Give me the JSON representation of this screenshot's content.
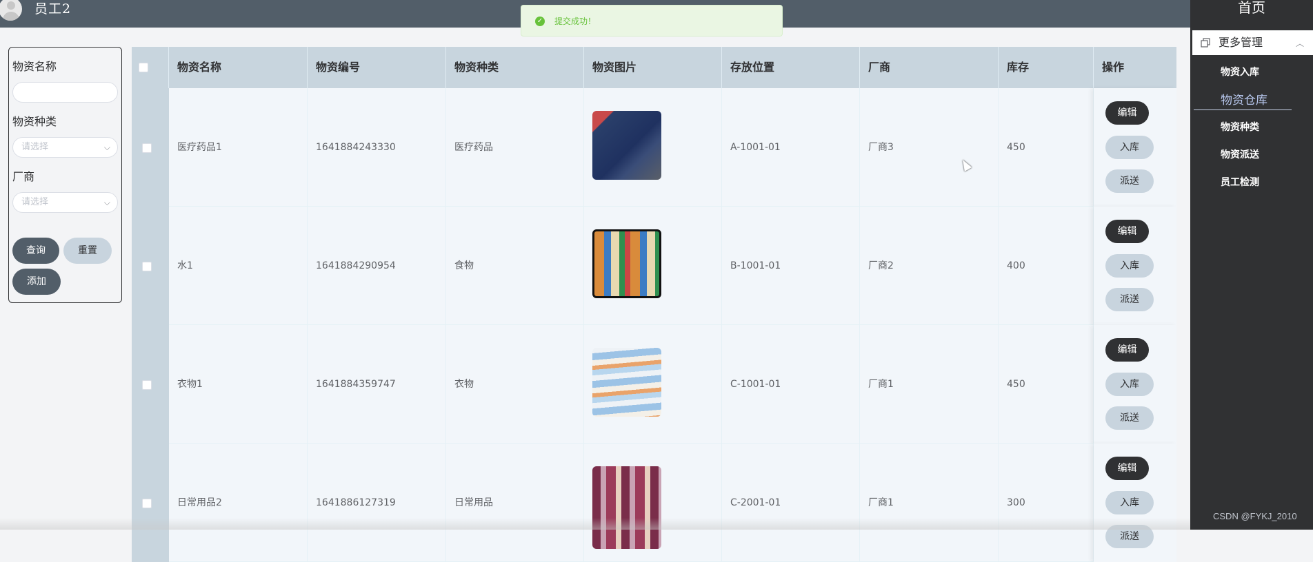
{
  "header": {
    "username": "员工2"
  },
  "toast": {
    "message": "提交成功！"
  },
  "sidebar": {
    "home": "首页",
    "group_label": "更多管理",
    "items": [
      "物资入库",
      "物资仓库",
      "物资种类",
      "物资派送",
      "员工检测"
    ],
    "active": "物资仓库"
  },
  "filter": {
    "name_label": "物资名称",
    "name_value": "",
    "type_label": "物资种类",
    "type_placeholder": "请选择",
    "vendor_label": "厂商",
    "vendor_placeholder": "请选择",
    "query_label": "查询",
    "reset_label": "重置",
    "add_label": "添加"
  },
  "table": {
    "columns": [
      "物资名称",
      "物资编号",
      "物资种类",
      "物资图片",
      "存放位置",
      "厂商",
      "库存",
      "操作"
    ],
    "rows": [
      {
        "name": "医疗药品1",
        "code": "1641884243330",
        "type": "医疗药品",
        "location": "A-1001-01",
        "vendor": "厂商3",
        "stock": "450"
      },
      {
        "name": "水1",
        "code": "1641884290954",
        "type": "食物",
        "location": "B-1001-01",
        "vendor": "厂商2",
        "stock": "400"
      },
      {
        "name": "衣物1",
        "code": "1641884359747",
        "type": "衣物",
        "location": "C-1001-01",
        "vendor": "厂商1",
        "stock": "450"
      },
      {
        "name": "日常用品2",
        "code": "1641886127319",
        "type": "日常用品",
        "location": "C-2001-01",
        "vendor": "厂商1",
        "stock": "300"
      }
    ],
    "actions": {
      "edit": "编辑",
      "in": "入库",
      "dispatch": "派送"
    }
  },
  "watermark": "CSDN @FYKJ_2010",
  "colors": {
    "topbar": "#525e69",
    "sidebar": "#303133",
    "table_header": "#c8d5de",
    "success": "#67c23a"
  }
}
